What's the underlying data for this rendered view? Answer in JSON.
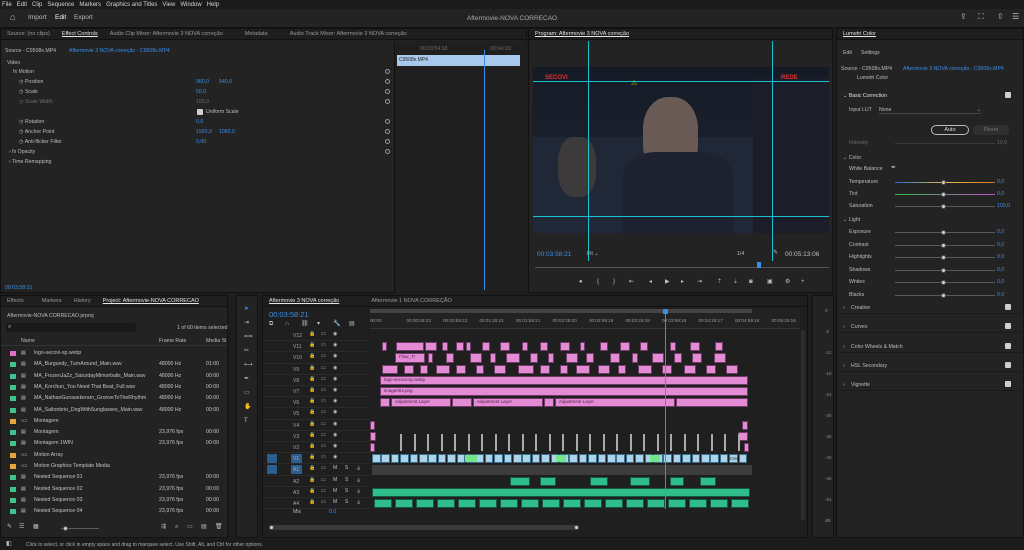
{
  "menu": [
    "File",
    "Edit",
    "Clip",
    "Sequence",
    "Markers",
    "Graphics and Titles",
    "View",
    "Window",
    "Help"
  ],
  "workspace": {
    "import": "Import",
    "edit": "Edit",
    "export": "Export",
    "title": "Aftermovie-NOVA CORRECAO"
  },
  "effect_controls": {
    "tabs": [
      "Source: (no clips)",
      "Effect Controls",
      "Audio Clip Mixer: Aftermovie 3 NOVA correção",
      "Metadata",
      "Audio Track Mixer: Aftermovie 3 NOVA correção"
    ],
    "source_line": "Source - C9508x.MP4",
    "seq_line": "Aftermovie 3 NOVA correção - C9508x.MP4",
    "video": "Video",
    "motion": "Motion",
    "position": {
      "label": "Position",
      "x": "960,0",
      "y": "540,0"
    },
    "scale": {
      "label": "Scale",
      "value": "50,0"
    },
    "scale_width": {
      "label": "Scale Width",
      "value": "100,0"
    },
    "uniform": "Uniform Scale",
    "rotation": {
      "label": "Rotation",
      "value": "0,0"
    },
    "anchor": {
      "label": "Anchor Point",
      "x": "1920,0",
      "y": "1080,0"
    },
    "antiflicker": {
      "label": "Anti-flicker Filter",
      "value": "0,00"
    },
    "opacity": "Opacity",
    "time_remap": "Time Remapping",
    "mini_t1": "00:03:54:18",
    "mini_t2": "00:04:19:",
    "clip": "C9508x.MP4",
    "timecode": "00:03:58:21"
  },
  "program": {
    "title": "Program: Aftermovie 3 NOVA correção",
    "timecode": "00:03:58:21",
    "fit": "Fit",
    "ratio": "1/4",
    "duration": "00:05:13:06",
    "logo_left": "SECOVI",
    "logo_right": "REDE"
  },
  "project": {
    "tabs": [
      "Effects",
      "Markers",
      "History",
      "Project: Aftermovie-NOVA CORRECAO"
    ],
    "file": "Aftermovie-NOVA CORRECAO.prproj",
    "selected": "1 of 60 items selected",
    "cols": [
      "Name",
      "Frame Rate",
      "Media St"
    ],
    "items": [
      {
        "name": "logo-secovi-sp.webp",
        "rate": "",
        "start": "",
        "color": "#e06fc7"
      },
      {
        "name": "MA_Burgundy_TurnAround_Main.wav",
        "rate": "48000 Hz",
        "start": "01:00",
        "color": "#3ec48a"
      },
      {
        "name": "MA_FrozenJaZz_SaturdayMimorbalis_Main.wav",
        "rate": "48000 Hz",
        "start": "00:00",
        "color": "#3ec48a"
      },
      {
        "name": "MA_Korchun_You Need That Beat_Full.wav",
        "rate": "48000 Hz",
        "start": "00:00",
        "color": "#3ec48a"
      },
      {
        "name": "MA_NathanGunasekeram_GrooveToTheRhythm",
        "rate": "48000 Hz",
        "start": "00:00",
        "color": "#3ec48a"
      },
      {
        "name": "MA_Saltonbrio_DogWithSunglasses_Main.wav",
        "rate": "48000 Hz",
        "start": "00:00",
        "color": "#3ec48a"
      },
      {
        "name": "Montagem",
        "rate": "",
        "start": "",
        "color": "#e2a63a"
      },
      {
        "name": "Montagem",
        "rate": "23,976 fps",
        "start": "00:00",
        "color": "#3ec48a"
      },
      {
        "name": "Montagem 1WIN",
        "rate": "23,976 fps",
        "start": "00:00",
        "color": "#3ec48a"
      },
      {
        "name": "Motion Array",
        "rate": "",
        "start": "",
        "color": "#e2a63a"
      },
      {
        "name": "Motion Graphics Template Media",
        "rate": "",
        "start": "",
        "color": "#e2a63a"
      },
      {
        "name": "Nested Sequence 01",
        "rate": "23,976 fps",
        "start": "00:00",
        "color": "#3ec48a"
      },
      {
        "name": "Nested Sequence 02",
        "rate": "23,976 fps",
        "start": "00:00",
        "color": "#3ec48a"
      },
      {
        "name": "Nested Sequence 03",
        "rate": "23,976 fps",
        "start": "00:00",
        "color": "#3ec48a"
      },
      {
        "name": "Nested Sequence 04",
        "rate": "23,976 fps",
        "start": "00:00",
        "color": "#3ec48a"
      }
    ]
  },
  "timeline": {
    "tabs": [
      "Aftermovie 3 NOVA correção",
      "Aftermovie 1 NOVA CORREÇÃO"
    ],
    "timecode": "00:03:58:21",
    "ruler": [
      "00:00",
      "00:00:29:23",
      "00:00:59:22",
      "00:01:29:21",
      "00:01:59:21",
      "00:02:29:20",
      "00:02:59:19",
      "00:03:29:18",
      "00:03:59:18",
      "00:04:29:17",
      "00:04:59:16",
      "00:05:29:16"
    ],
    "tracks": [
      "V12",
      "V11",
      "V10",
      "V9",
      "V8",
      "V7",
      "V6",
      "V5",
      "V4",
      "V3",
      "V2",
      "V1",
      "A1",
      "A2",
      "A3",
      "A4"
    ],
    "mix": "Mix",
    "mix_val": "0,0",
    "clip_logo": "logo-secovi-sp.webp",
    "clip_image": "image004.png",
    "adjustment": "Adjustment Layer",
    "flow": "Flow_Tr",
    "v1_label": "C94"
  },
  "lumetri": {
    "title": "Lumetri Color",
    "tabs": [
      "Edit",
      "Settings"
    ],
    "source": "Source - C9508x.MP4",
    "seq": "Aftermovie 3 NOVA correção - C9508x.MP4",
    "effect": "Lumetri Color",
    "basic": "Basic Correction",
    "lut_label": "Input LUT",
    "lut_value": "None",
    "auto": "Auto",
    "reset": "Reset",
    "intensity": {
      "label": "Intensity",
      "value": "10,0"
    },
    "color_hdr": "Color",
    "wb": "White Balance",
    "temperature": {
      "label": "Temperature",
      "value": "0,0"
    },
    "tint": {
      "label": "Tint",
      "value": "0,0"
    },
    "saturation": {
      "label": "Saturation",
      "value": "100,0"
    },
    "light_hdr": "Light",
    "light": [
      {
        "label": "Exposure",
        "value": "0,0"
      },
      {
        "label": "Contrast",
        "value": "0,0"
      },
      {
        "label": "Highlights",
        "value": "0,0"
      },
      {
        "label": "Shadows",
        "value": "0,0"
      },
      {
        "label": "Whites",
        "value": "0,0"
      },
      {
        "label": "Blacks",
        "value": "0,0"
      }
    ],
    "sections": [
      "Creative",
      "Curves",
      "Color Wheels & Match",
      "HSL Secondary",
      "Vignette"
    ]
  },
  "audio_meter": {
    "ticks": [
      "0",
      "-6",
      "-12",
      "-18",
      "-24",
      "-30",
      "-36",
      "-42",
      "-48",
      "-54",
      "dB"
    ]
  },
  "status": "Click to select, or click in empty space and drag to marquee select. Use Shift, Alt, and Ctrl for other options."
}
